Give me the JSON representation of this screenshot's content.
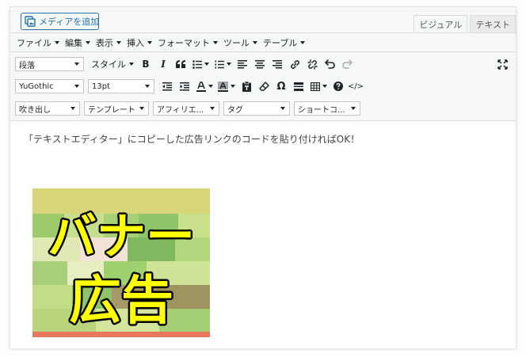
{
  "media_button": {
    "label": "メディアを追加"
  },
  "tabs": [
    {
      "label": "ビジュアル",
      "active": true
    },
    {
      "label": "テキスト",
      "active": false
    }
  ],
  "menu": [
    {
      "label": "ファイル"
    },
    {
      "label": "編集"
    },
    {
      "label": "表示"
    },
    {
      "label": "挿入"
    },
    {
      "label": "フォーマット"
    },
    {
      "label": "ツール"
    },
    {
      "label": "テーブル"
    }
  ],
  "toolbar": {
    "format_select": "段落",
    "style_select": "スタイル",
    "font_family": "YuGothic",
    "font_size": "13pt",
    "row3": [
      "吹き出し",
      "テンプレート",
      "アフィリエ...",
      "タグ",
      "ショートコ..."
    ],
    "bold": "B",
    "italic": "I",
    "blockquote": "66",
    "omega": "Ω",
    "code": "</>"
  },
  "content": {
    "paragraph": "「テキストエディター」にコピーした広告リンクのコードを貼り付ければOK！",
    "banner_text_line1": "バナー",
    "banner_text_line2": "広告"
  },
  "colors": {
    "accent": "#2271b1",
    "banner_yellow": "#ffff00",
    "banner_stroke": "#000000"
  }
}
